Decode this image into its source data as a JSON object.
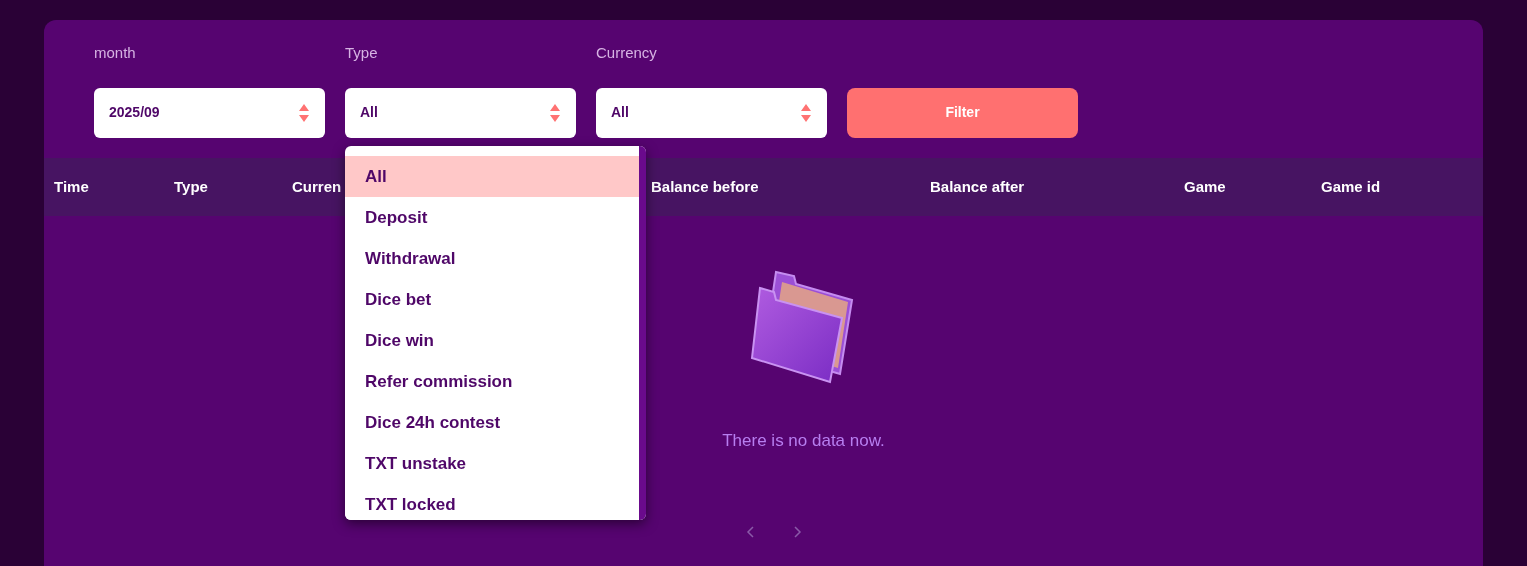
{
  "filters": [
    {
      "label": "month",
      "value": "2025/09"
    },
    {
      "label": "Type",
      "value": "All"
    },
    {
      "label": "Currency",
      "value": "All"
    }
  ],
  "filter_button": "Filter",
  "table": {
    "columns": [
      "Time",
      "Type",
      "Curren",
      "Balance before",
      "Balance after",
      "Game",
      "Game id"
    ]
  },
  "empty_message": "There is no data now.",
  "type_dropdown": {
    "options": [
      {
        "label": "All",
        "selected": true
      },
      {
        "label": "Deposit",
        "selected": false
      },
      {
        "label": "Withdrawal",
        "selected": false
      },
      {
        "label": "Dice bet",
        "selected": false
      },
      {
        "label": "Dice win",
        "selected": false
      },
      {
        "label": "Refer commission",
        "selected": false
      },
      {
        "label": "Dice 24h contest",
        "selected": false
      },
      {
        "label": "TXT unstake",
        "selected": false
      },
      {
        "label": "TXT locked",
        "selected": false
      }
    ]
  }
}
